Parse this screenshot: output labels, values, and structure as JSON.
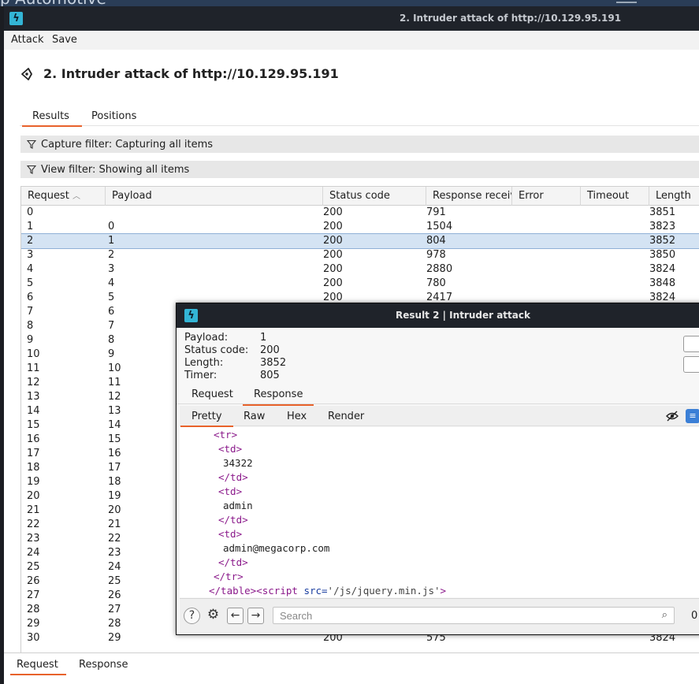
{
  "background": {
    "app_name": "p Automotive"
  },
  "window": {
    "title": "2. Intruder attack of http://10.129.95.191",
    "icon": "burp-icon"
  },
  "menu": [
    "Attack",
    "Save"
  ],
  "page_title": "2. Intruder attack of http://10.129.95.191",
  "tabs": [
    "Results",
    "Positions"
  ],
  "capture_filter": "Capture filter: Capturing all items",
  "view_filter": "View filter: Showing all items",
  "table": {
    "columns": [
      "Request",
      "Payload",
      "Status code",
      "Response receiv...",
      "Error",
      "Timeout",
      "Length"
    ],
    "sort_indicator": "ascending",
    "selected_row": 2,
    "rows": [
      [
        "0",
        "",
        "200",
        "791",
        "",
        "",
        "3851"
      ],
      [
        "1",
        "0",
        "200",
        "1504",
        "",
        "",
        "3823"
      ],
      [
        "2",
        "1",
        "200",
        "804",
        "",
        "",
        "3852"
      ],
      [
        "3",
        "2",
        "200",
        "978",
        "",
        "",
        "3850"
      ],
      [
        "4",
        "3",
        "200",
        "2880",
        "",
        "",
        "3824"
      ],
      [
        "5",
        "4",
        "200",
        "780",
        "",
        "",
        "3848"
      ],
      [
        "6",
        "5",
        "200",
        "2417",
        "",
        "",
        "3824"
      ],
      [
        "7",
        "6",
        "",
        "",
        "",
        "",
        ""
      ],
      [
        "8",
        "7",
        "",
        "",
        "",
        "",
        ""
      ],
      [
        "9",
        "8",
        "",
        "",
        "",
        "",
        ""
      ],
      [
        "10",
        "9",
        "",
        "",
        "",
        "",
        ""
      ],
      [
        "11",
        "10",
        "",
        "",
        "",
        "",
        ""
      ],
      [
        "12",
        "11",
        "",
        "",
        "",
        "",
        ""
      ],
      [
        "13",
        "12",
        "",
        "",
        "",
        "",
        ""
      ],
      [
        "14",
        "13",
        "",
        "",
        "",
        "",
        ""
      ],
      [
        "15",
        "14",
        "",
        "",
        "",
        "",
        ""
      ],
      [
        "16",
        "15",
        "",
        "",
        "",
        "",
        ""
      ],
      [
        "17",
        "16",
        "",
        "",
        "",
        "",
        ""
      ],
      [
        "18",
        "17",
        "",
        "",
        "",
        "",
        ""
      ],
      [
        "19",
        "18",
        "",
        "",
        "",
        "",
        ""
      ],
      [
        "20",
        "19",
        "",
        "",
        "",
        "",
        ""
      ],
      [
        "21",
        "20",
        "",
        "",
        "",
        "",
        ""
      ],
      [
        "22",
        "21",
        "",
        "",
        "",
        "",
        ""
      ],
      [
        "23",
        "22",
        "",
        "",
        "",
        "",
        ""
      ],
      [
        "24",
        "23",
        "",
        "",
        "",
        "",
        ""
      ],
      [
        "25",
        "24",
        "",
        "",
        "",
        "",
        ""
      ],
      [
        "26",
        "25",
        "",
        "",
        "",
        "",
        ""
      ],
      [
        "27",
        "26",
        "",
        "",
        "",
        "",
        ""
      ],
      [
        "28",
        "27",
        "",
        "",
        "",
        "",
        ""
      ],
      [
        "29",
        "28",
        "",
        "",
        "",
        "",
        ""
      ],
      [
        "30",
        "29",
        "200",
        "575",
        "",
        "",
        "3824"
      ]
    ]
  },
  "bottom_tabs": [
    "Request",
    "Response"
  ],
  "popup": {
    "title": "Result 2 | Intruder attack",
    "fields": [
      {
        "label": "Payload:",
        "value": "1"
      },
      {
        "label": "Status code:",
        "value": "200"
      },
      {
        "label": "Length:",
        "value": "3852"
      },
      {
        "label": "Timer:",
        "value": "805"
      }
    ],
    "tabs": [
      "Request",
      "Response"
    ],
    "active_tab": "Response",
    "view_tabs": [
      "Pretty",
      "Raw",
      "Hex",
      "Render"
    ],
    "active_view_tab": "Pretty",
    "code_lines": [
      [
        {
          "t": "<tr>",
          "c": "tag"
        }
      ],
      [
        {
          "t": "<td>",
          "c": "tag"
        }
      ],
      [
        {
          "t": "34322",
          "c": "pln"
        }
      ],
      [
        {
          "t": "</td>",
          "c": "tag"
        }
      ],
      [
        {
          "t": "<td>",
          "c": "tag"
        }
      ],
      [
        {
          "t": "admin",
          "c": "pln"
        }
      ],
      [
        {
          "t": "</td>",
          "c": "tag"
        }
      ],
      [
        {
          "t": "<td>",
          "c": "tag"
        }
      ],
      [
        {
          "t": "admin@megacorp.com",
          "c": "pln"
        }
      ],
      [
        {
          "t": "</td>",
          "c": "tag"
        }
      ],
      [
        {
          "t": "</tr>",
          "c": "tag"
        }
      ],
      [
        {
          "t": "</table>",
          "c": "tag"
        },
        {
          "t": "<script ",
          "c": "tag"
        },
        {
          "t": "src=",
          "c": "attr"
        },
        {
          "t": "'/js/jquery.min.js'",
          "c": "str"
        },
        {
          "t": ">",
          "c": "tag"
        }
      ]
    ],
    "search_placeholder": "Search",
    "match_count": "0",
    "icons": [
      "help-icon",
      "settings-icon",
      "back-arrow-icon",
      "forward-arrow-icon",
      "search-icon",
      "hide-nonprinting-icon",
      "wrap-lines-icon"
    ]
  },
  "colors": {
    "accent": "#e8622b",
    "title_bar": "#1f232a",
    "selected_row": "#d4e3f3",
    "tag": "#8b1a8b"
  }
}
